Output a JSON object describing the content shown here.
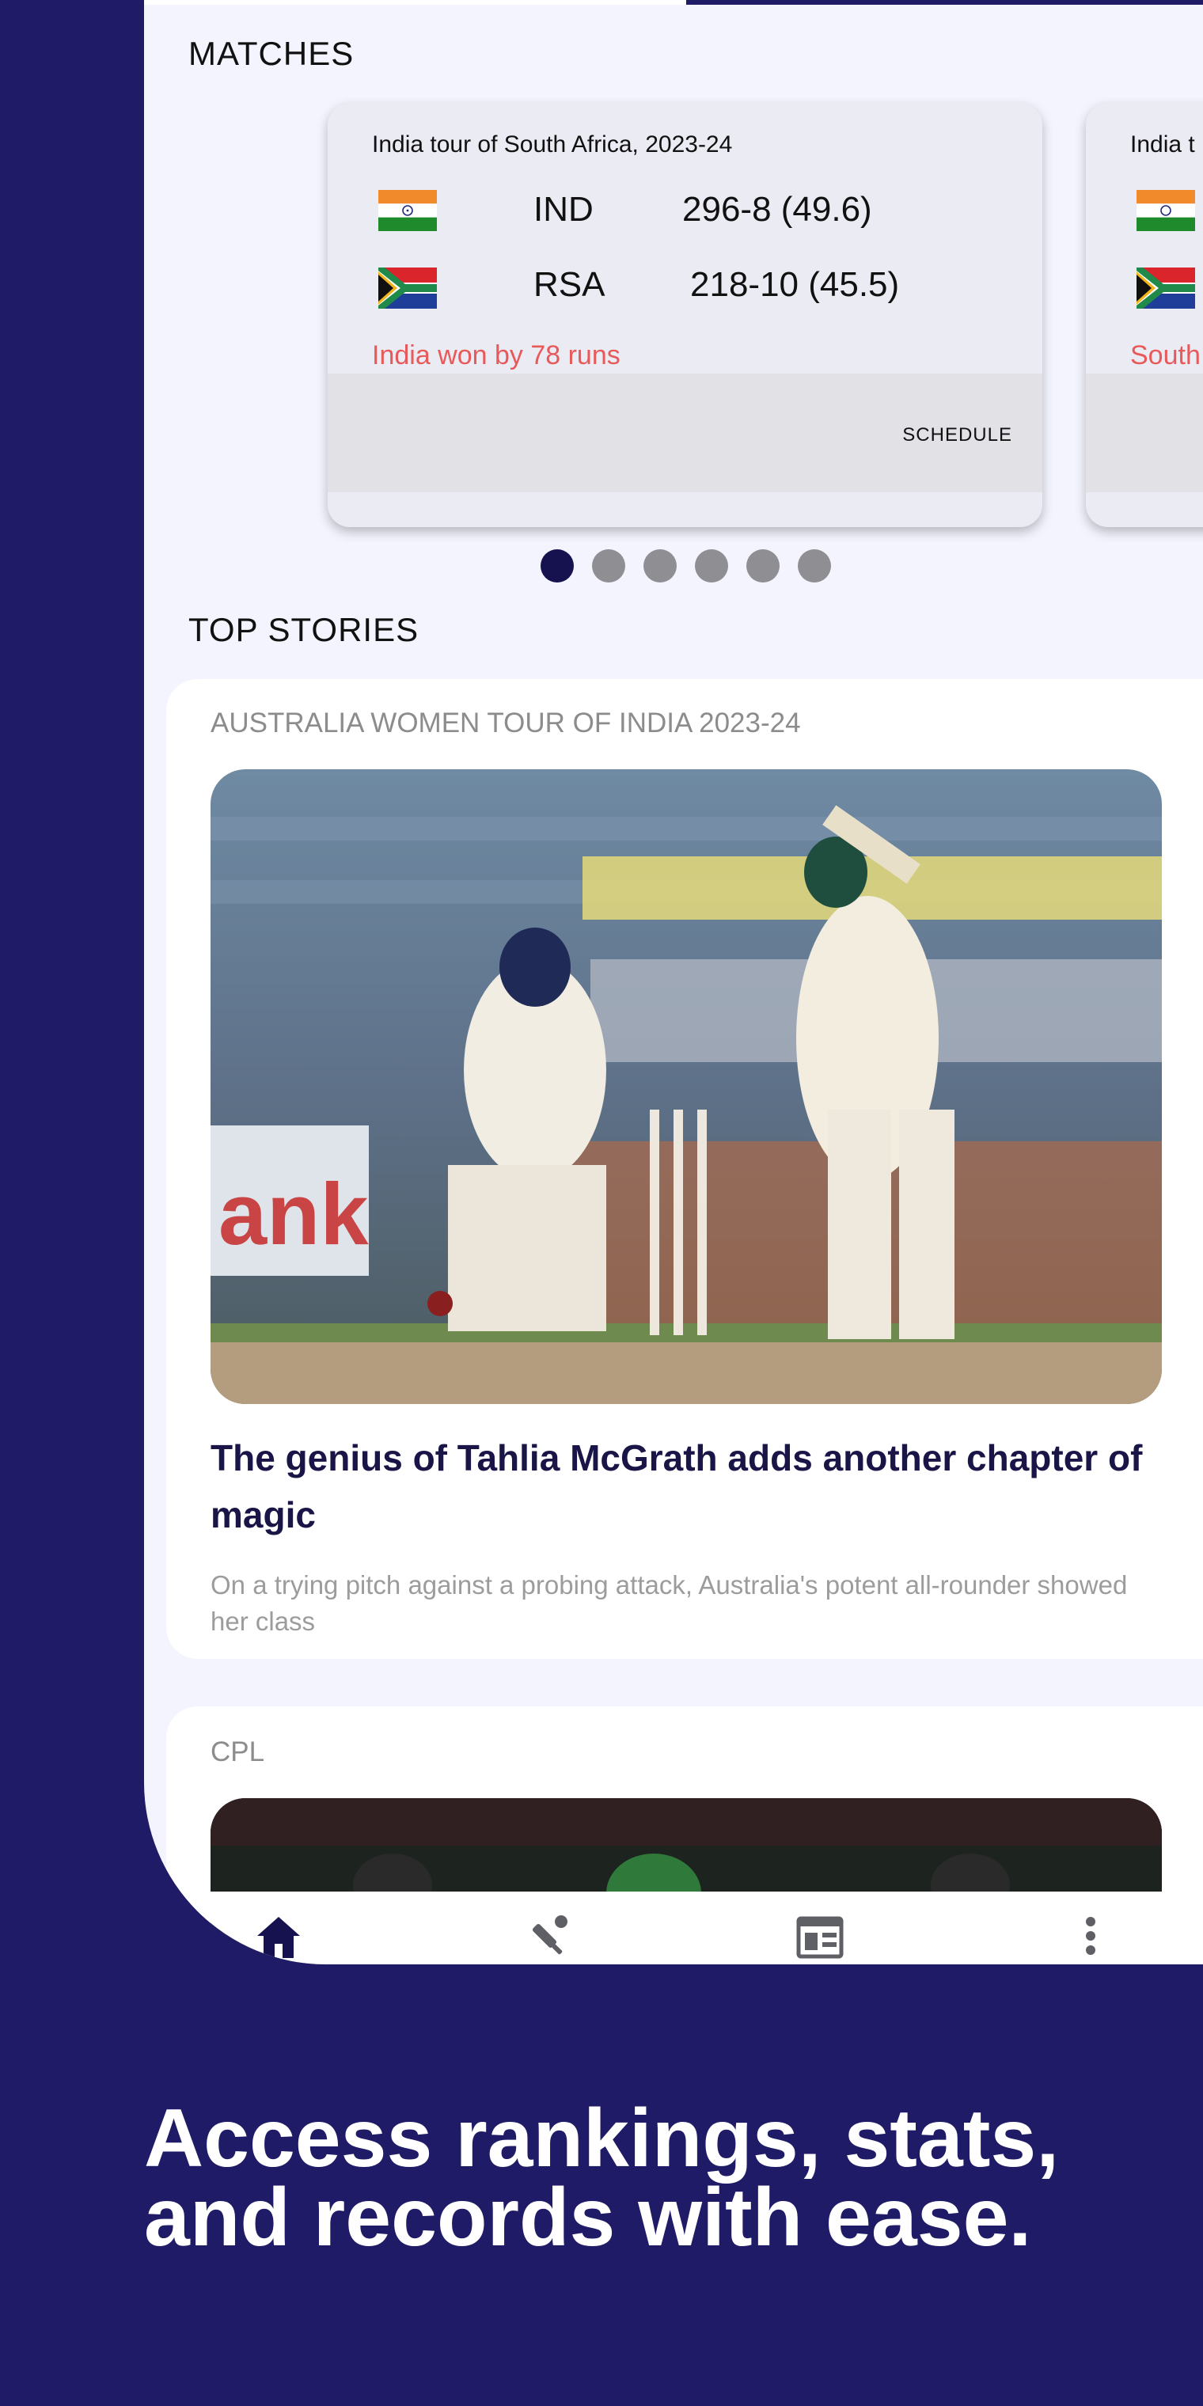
{
  "matches": {
    "section_title": "MATCHES",
    "cards": [
      {
        "series": "India tour of South Africa, 2023-24",
        "team1": {
          "abbr": "IND",
          "score": "296-8 (49.6)",
          "flag": "india-flag-icon"
        },
        "team2": {
          "abbr": "RSA",
          "score": "218-10 (45.5)",
          "flag": "south-africa-flag-icon"
        },
        "result": "India won by 78 runs",
        "button": "SCHEDULE"
      },
      {
        "series": "India t",
        "result": "South"
      }
    ],
    "pagination": {
      "total": 6,
      "active_index": 0
    }
  },
  "top_stories": {
    "section_title": "TOP STORIES",
    "stories": [
      {
        "category": "AUSTRALIA WOMEN TOUR OF INDIA 2023-24",
        "headline": "The genius of Tahlia McGrath adds another chapter of magic",
        "summary": "On a trying pitch against a probing attack, Australia's potent all-rounder showed her class",
        "image": "cricket-batter-photo"
      },
      {
        "category": "CPL",
        "image": "cpl-photo"
      }
    ]
  },
  "bottom_nav": {
    "items": [
      "home-icon",
      "cricket-bat-icon",
      "news-icon",
      "more-icon"
    ],
    "active": "home-icon"
  },
  "tagline": "Access rankings, stats, and records with ease.",
  "colors": {
    "background": "#1f1b66",
    "screen": "#f3f4fe",
    "result_red": "#e8595a",
    "active_dot": "#15124f",
    "headline": "#191547"
  }
}
